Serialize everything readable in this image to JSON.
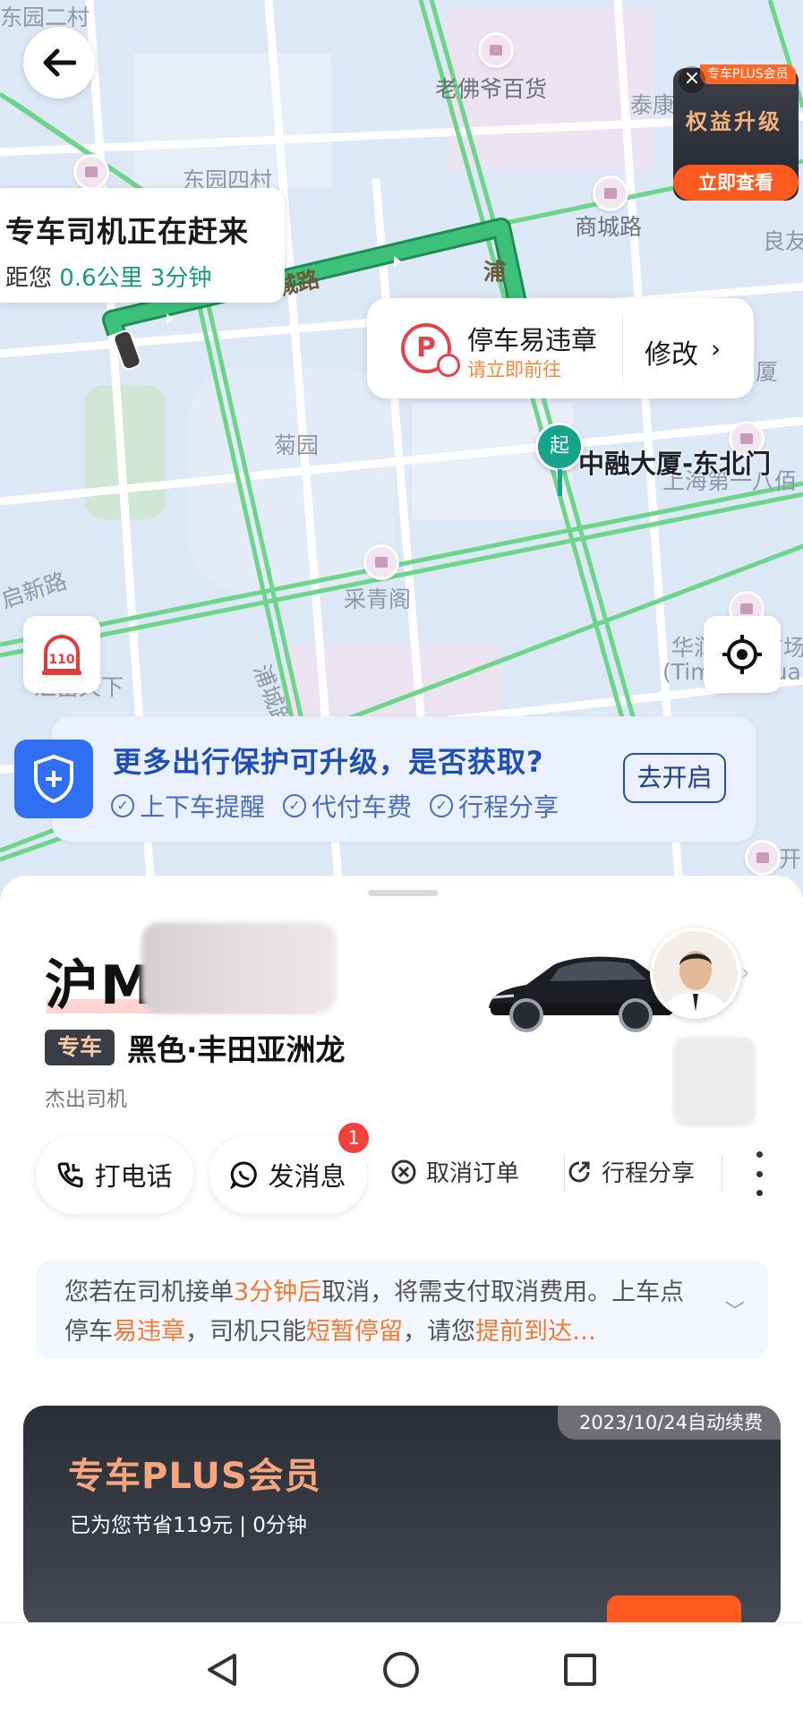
{
  "map": {
    "labels": {
      "dongyuan_ercun": "东园二村",
      "dongyuan_sicun": "东园四村",
      "laofoye": "老佛爷百货",
      "taikang": "泰康",
      "shangcheng_road_metro": "商城路",
      "liangyou": "良友",
      "shangcheng_road_street": "商城路",
      "pu_street": "浦",
      "xia": "厦",
      "juyuan": "菊园",
      "shanghai_diyi": "上海第一八佰",
      "caiqingge": "采青阁",
      "qixin_road": "启新路",
      "pucheng_road": "浦城路",
      "jintiandixia": "汇富天下",
      "huaxia_times": "华润时代广场",
      "times_square": "(Times Square",
      "kai": "开"
    },
    "back_icon": "arrow-left-icon",
    "driver_status": {
      "title": "专车司机正在赶来",
      "prefix": "距您",
      "distance": "0.6公里",
      "eta": "3分钟"
    },
    "plus_promo": {
      "tag": "专车PLUS会员",
      "title": "权益升级",
      "cta": "立即查看"
    },
    "parking": {
      "icon_letter": "P",
      "title": "停车易违章",
      "subtitle": "请立即前往",
      "action": "修改"
    },
    "start_pin": {
      "label": "起",
      "place": "中融大厦-东北门"
    },
    "police_icon_text": "110",
    "protection": {
      "title": "更多出行保护可升级，是否获取?",
      "tags": [
        "上下车提醒",
        "代付车费",
        "行程分享"
      ],
      "button": "去开启"
    },
    "colors": {
      "route": "#2db36b",
      "road_traffic": "#6cd58a",
      "accent_teal": "#16a58a"
    }
  },
  "sheet": {
    "plate_prefix": "沪M",
    "car_badge": "专车",
    "car_desc": "黑色·丰田亚洲龙",
    "driver_title": "杰出司机",
    "actions": {
      "call": "打电话",
      "message": "发消息",
      "unread": "1",
      "cancel": "取消订单",
      "share": "行程分享"
    },
    "notice": {
      "p1": "您若在司机接单",
      "h1": "3分钟后",
      "p2": "取消，将需支付取消费用。上车点停车",
      "h2": "易违章",
      "p3": "，司机只能",
      "h3": "短暂停留",
      "p4": "，请您",
      "h4": "提前到达…"
    },
    "plus_card": {
      "renew": "2023/10/24自动续费",
      "title": "专车PLUS会员",
      "sub": "已为您节省119元 | 0分钟"
    }
  }
}
